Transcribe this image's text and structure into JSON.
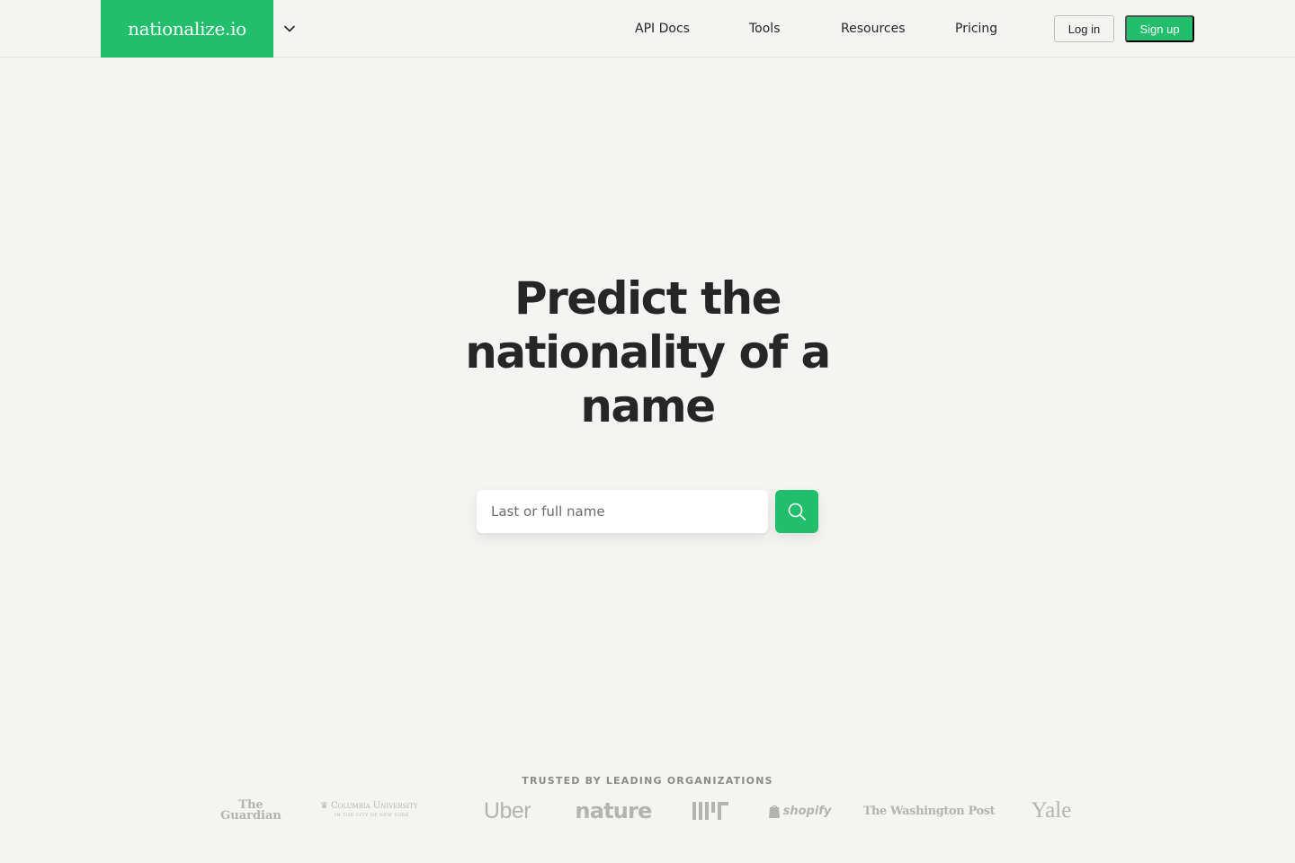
{
  "header": {
    "brand": "nationalize.io",
    "nav": [
      "API Docs",
      "Tools",
      "Resources",
      "Pricing"
    ],
    "login_label": "Log in",
    "signup_label": "Sign up"
  },
  "hero": {
    "title": "Predict the nationality of a name",
    "search_placeholder": "Last or full name"
  },
  "trusted": {
    "label": "TRUSTED BY LEADING ORGANIZATIONS",
    "logos": [
      {
        "name": "The Guardian",
        "line1": "The",
        "line2": "Guardian"
      },
      {
        "name": "Columbia University",
        "line1": "Columbia University",
        "line2": "IN THE CITY OF NEW YORK"
      },
      {
        "name": "Uber",
        "text": "Uber"
      },
      {
        "name": "nature",
        "text": "nature"
      },
      {
        "name": "MIT",
        "text": "MIT"
      },
      {
        "name": "shopify",
        "text": "shopify"
      },
      {
        "name": "The Washington Post",
        "text": "The Washington Post"
      },
      {
        "name": "Yale",
        "text": "Yale"
      }
    ]
  },
  "colors": {
    "accent": "#21bf6b",
    "background": "#f4f4f2",
    "text": "#262626",
    "logo_gray": "#b3b3b1"
  },
  "icons": {
    "brand_toggle": "chevron-down-icon",
    "search_button": "search-icon"
  }
}
